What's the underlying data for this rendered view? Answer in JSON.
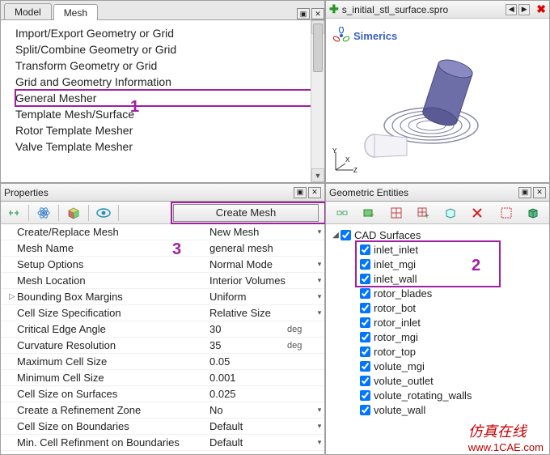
{
  "tabs": {
    "model": "Model",
    "mesh": "Mesh"
  },
  "tree": {
    "items": [
      "Import/Export Geometry or Grid",
      "Split/Combine Geometry or Grid",
      "Transform Geometry or Grid",
      "Grid and Geometry Information",
      "General Mesher",
      "Template Mesh/Surface",
      "Rotor Template Mesher",
      "Valve Template Mesher"
    ],
    "highlight_index": 4
  },
  "viewer": {
    "filename": "s_initial_stl_surface.spro",
    "brand": "Simerics"
  },
  "properties": {
    "title": "Properties",
    "create_button": "Create Mesh",
    "rows": [
      {
        "label": "Create/Replace Mesh",
        "value": "New Mesh",
        "dd": true
      },
      {
        "label": "Mesh Name",
        "value": "general mesh"
      },
      {
        "label": "Setup Options",
        "value": "Normal Mode",
        "dd": true
      },
      {
        "label": "Mesh Location",
        "value": "Interior Volumes",
        "dd": true
      },
      {
        "label": "Bounding Box Margins",
        "value": "Uniform",
        "dd": true,
        "expander": "▷"
      },
      {
        "label": "Cell Size Specification",
        "value": "Relative Size",
        "dd": true
      },
      {
        "label": "Critical Edge Angle",
        "value": "30",
        "unit": "deg"
      },
      {
        "label": "Curvature Resolution",
        "value": "35",
        "unit": "deg"
      },
      {
        "label": "Maximum Cell Size",
        "value": "0.05"
      },
      {
        "label": "Minimum Cell Size",
        "value": "0.001"
      },
      {
        "label": "Cell Size on Surfaces",
        "value": "0.025"
      },
      {
        "label": "Create a Refinement Zone",
        "value": "No",
        "dd": true
      },
      {
        "label": "Cell Size on Boundaries",
        "value": "Default",
        "dd": true
      },
      {
        "label": "Min. Cell Refinment on Boundaries",
        "value": "Default",
        "dd": true
      }
    ]
  },
  "entities": {
    "title": "Geometric Entities",
    "root": "CAD Surfaces",
    "items": [
      "inlet_inlet",
      "inlet_mgi",
      "inlet_wall",
      "rotor_blades",
      "rotor_bot",
      "rotor_inlet",
      "rotor_mgi",
      "rotor_top",
      "volute_mgi",
      "volute_outlet",
      "volute_rotating_walls",
      "volute_wall"
    ],
    "highlight_range": [
      0,
      2
    ]
  },
  "annotations": {
    "a1": "1",
    "a2": "2",
    "a3": "3"
  },
  "watermark": {
    "cn": "仿真在线",
    "url": "www.1CAE.com"
  }
}
